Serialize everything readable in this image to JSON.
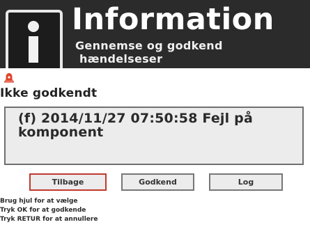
{
  "header": {
    "title": "Information",
    "subtitle_line1": "Gennemse og godkend",
    "subtitle_line2": "hændelseser",
    "icon": "info-icon"
  },
  "status": {
    "icon": "alarm-bell-icon",
    "icon_color": "#e0442b",
    "label": "Ikke godkendt"
  },
  "event": {
    "text": "(f) 2014/11/27 07:50:58 Fejl på komponent"
  },
  "buttons": {
    "back_label": "Tilbage",
    "approve_label": "Godkend",
    "log_label": "Log",
    "selected": "Tilbage",
    "selected_border_color": "#c0392b"
  },
  "help": {
    "line1": "Brug hjul for at vælge",
    "line2": "Tryk OK for at godkende",
    "line3": "Tryk RETUR for at annullere"
  }
}
